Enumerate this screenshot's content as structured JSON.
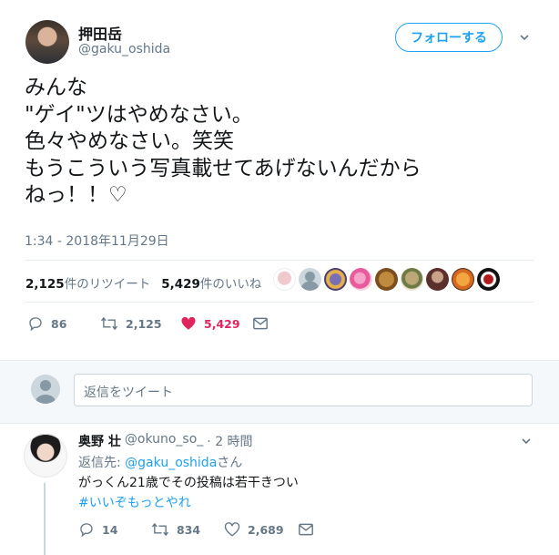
{
  "tweet": {
    "display_name": "押田岳",
    "handle": "@gaku_oshida",
    "follow_label": "フォローする",
    "text": "みんな\n\"ゲイ\"ツはやめなさい。\n色々やめなさい。笑笑\nもうこういう写真載せてあげないんだから\nねっ！！♡",
    "timestamp": "1:34 - 2018年11月29日",
    "retweets_count": "2,125",
    "retweets_label": "件のリツイート",
    "likes_count": "5,429",
    "likes_label": "件のいいね",
    "actions": {
      "replies": "86",
      "retweets": "2,125",
      "likes": "5,429"
    }
  },
  "reply_box": {
    "placeholder": "返信をツイート"
  },
  "reply": {
    "display_name": "奥野 壮",
    "handle": "@okuno_so_",
    "time": "· 2 時間",
    "reply_to_prefix": "返信先: ",
    "reply_to_handle": "@gaku_oshida",
    "reply_to_suffix": "さん",
    "text": "がっくん21歳でその投稿は若干きつい",
    "hashtag": "#いいぞもっとやれ",
    "actions": {
      "replies": "14",
      "retweets": "834",
      "likes": "2,689"
    }
  },
  "colors": {
    "accent": "#1da1f2",
    "like": "#e0245e",
    "muted": "#657786"
  }
}
